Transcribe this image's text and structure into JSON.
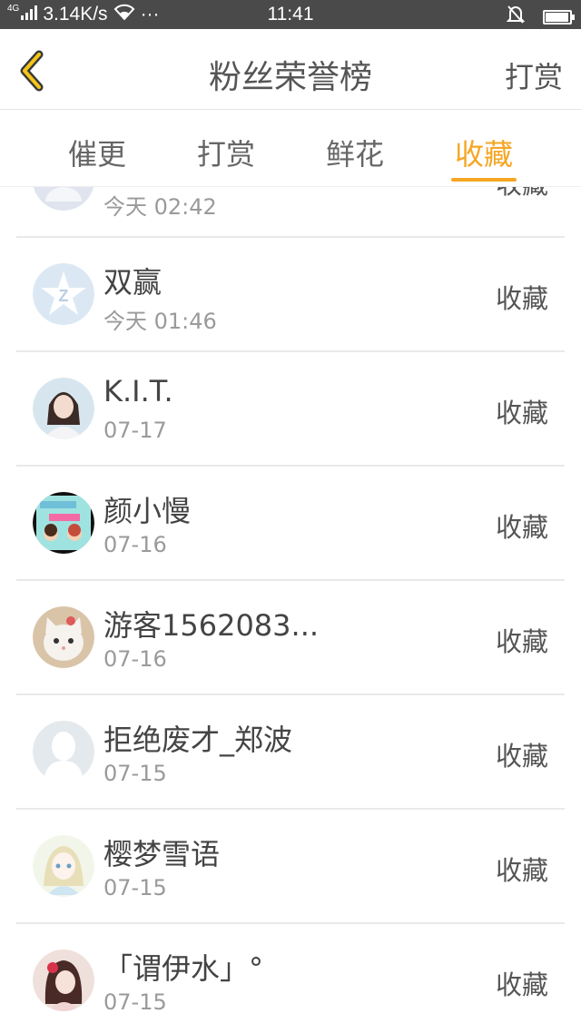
{
  "status_bar": {
    "network": "4G",
    "speed": "3.14K/s",
    "more": "···",
    "time": "11:41",
    "battery_level": 0.95
  },
  "header": {
    "title": "粉丝荣誉榜",
    "right_action": "打赏"
  },
  "tabs": [
    {
      "label": "催更"
    },
    {
      "label": "打赏"
    },
    {
      "label": "鲜花"
    },
    {
      "label": "收藏"
    }
  ],
  "active_tab": "收藏",
  "accent_color": "#f5a623",
  "rows": [
    {
      "name": "",
      "time": "今天 02:42",
      "action": "收藏",
      "avatar": "default-grey"
    },
    {
      "name": "双赢",
      "time": "今天 01:46",
      "action": "收藏",
      "avatar": "qq-star"
    },
    {
      "name": "K.I.T.",
      "time": "07-17",
      "action": "收藏",
      "avatar": "photo-girl"
    },
    {
      "name": "颜小慢",
      "time": "07-16",
      "action": "收藏",
      "avatar": "cartoon-book"
    },
    {
      "name": "游客1562083...",
      "time": "07-16",
      "action": "收藏",
      "avatar": "cat"
    },
    {
      "name": "拒绝废才_郑波",
      "time": "07-15",
      "action": "收藏",
      "avatar": "silhouette"
    },
    {
      "name": "樱梦雪语",
      "time": "07-15",
      "action": "收藏",
      "avatar": "anime-girl"
    },
    {
      "name": "「谓伊水」°",
      "time": "07-15",
      "action": "收藏",
      "avatar": "illustrated-girl"
    }
  ]
}
